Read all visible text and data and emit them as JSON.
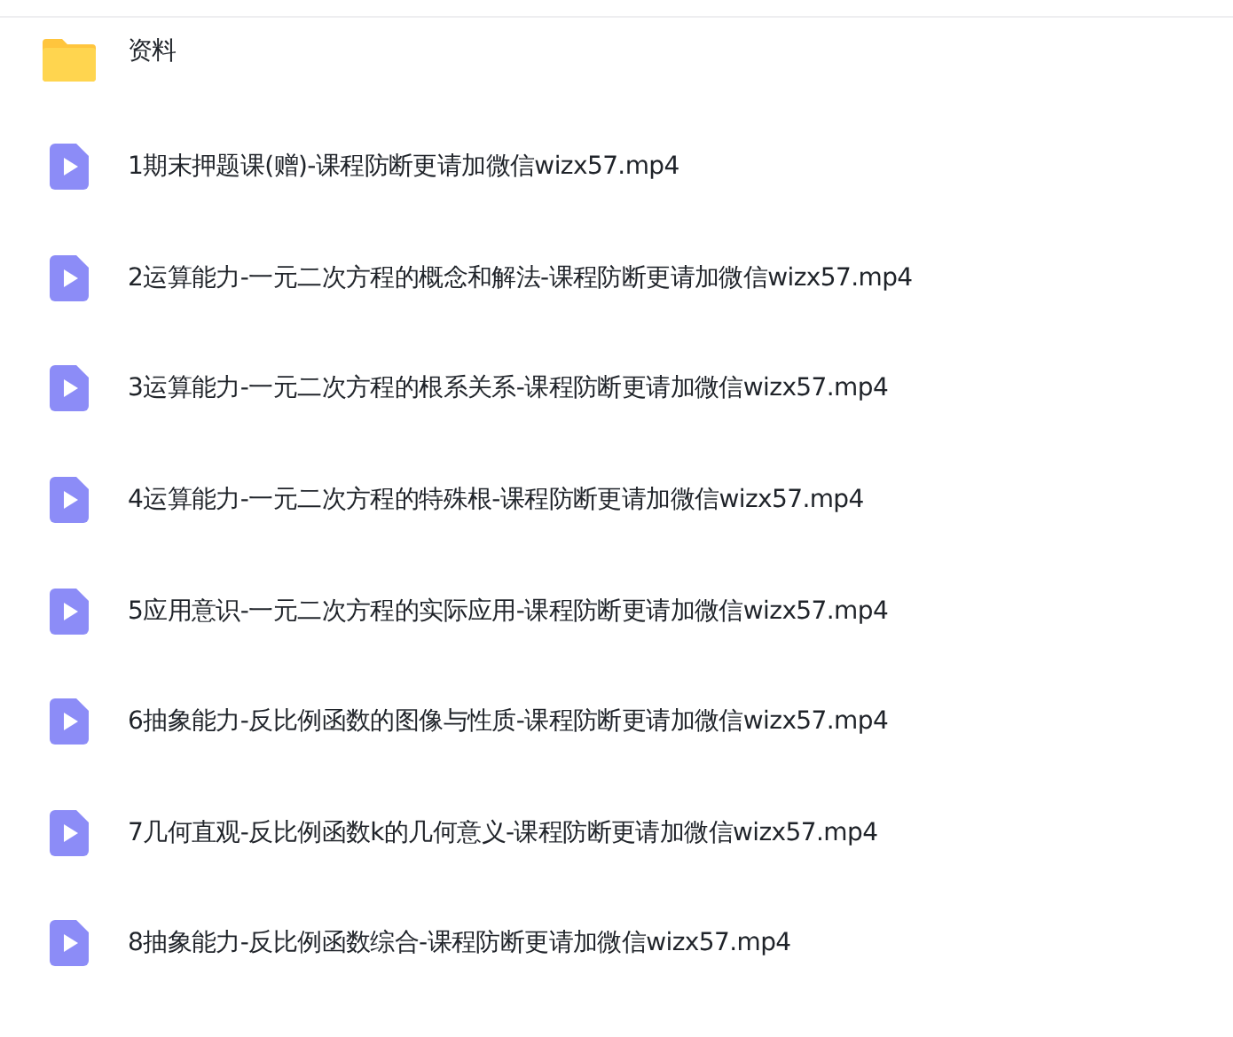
{
  "files": [
    {
      "kind": "folder",
      "name": "资料"
    },
    {
      "kind": "video",
      "name": "1期末押题课(赠)-课程防断更请加微信wizx57.mp4"
    },
    {
      "kind": "video",
      "name": "2运算能力-一元二次方程的概念和解法-课程防断更请加微信wizx57.mp4"
    },
    {
      "kind": "video",
      "name": "3运算能力-一元二次方程的根系关系-课程防断更请加微信wizx57.mp4"
    },
    {
      "kind": "video",
      "name": "4运算能力-一元二次方程的特殊根-课程防断更请加微信wizx57.mp4"
    },
    {
      "kind": "video",
      "name": "5应用意识-一元二次方程的实际应用-课程防断更请加微信wizx57.mp4"
    },
    {
      "kind": "video",
      "name": "6抽象能力-反比例函数的图像与性质-课程防断更请加微信wizx57.mp4"
    },
    {
      "kind": "video",
      "name": "7几何直观-反比例函数k的几何意义-课程防断更请加微信wizx57.mp4"
    },
    {
      "kind": "video",
      "name": "8抽象能力-反比例函数综合-课程防断更请加微信wizx57.mp4"
    }
  ]
}
